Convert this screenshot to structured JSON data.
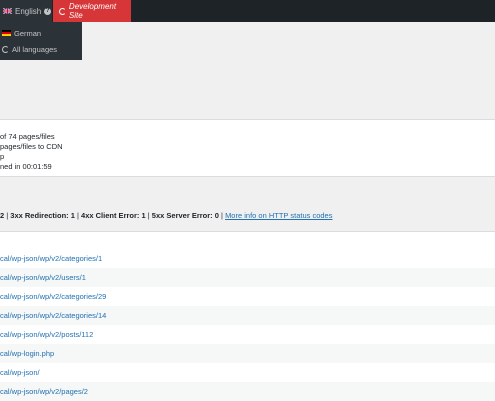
{
  "adminbar": {
    "language": {
      "label": "English",
      "flag_icon": "uk-flag-icon"
    },
    "dev_site": {
      "label": "Development Site"
    }
  },
  "language_menu": {
    "items": [
      {
        "label": "German",
        "icon": "de-flag-icon"
      },
      {
        "label": "All languages",
        "icon": "globe-icon"
      }
    ]
  },
  "result": {
    "lines": [
      "of 74 pages/files",
      "pages/files to CDN",
      "p",
      "ned in 00:01:59"
    ]
  },
  "status": {
    "prefix": "2",
    "redirection_label": "3xx Redirection:",
    "redirection_count": "1",
    "client_error_label": "4xx Client Error:",
    "client_error_count": "1",
    "server_error_label": "5xx Server Error:",
    "server_error_count": "0",
    "more_info_link": "More info on HTTP status codes"
  },
  "links": [
    "cal/wp-json/wp/v2/categories/1",
    "cal/wp-json/wp/v2/users/1",
    "cal/wp-json/wp/v2/categories/29",
    "cal/wp-json/wp/v2/categories/14",
    "cal/wp-json/wp/v2/posts/112",
    "cal/wp-login.php",
    "cal/wp-json/",
    "cal/wp-json/wp/v2/pages/2"
  ],
  "colors": {
    "adminbar_bg": "#1d2327",
    "dev_site_bg": "#d63638",
    "link": "#2271b1"
  }
}
